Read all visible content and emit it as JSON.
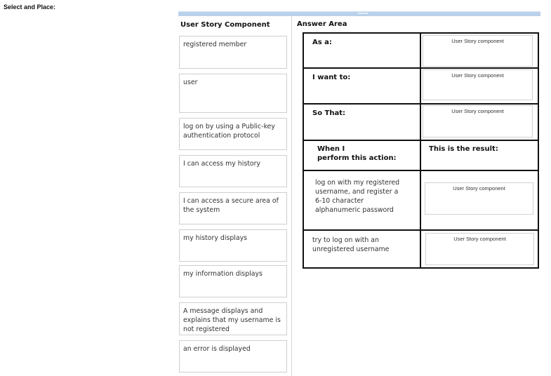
{
  "page": {
    "title": "Select and Place:"
  },
  "components_panel": {
    "heading": "User Story Component",
    "items": [
      {
        "label": "registered member"
      },
      {
        "label": "user"
      },
      {
        "label": "log on by using a Public-key authentication protocol"
      },
      {
        "label": "I can access my history"
      },
      {
        "label": "I can access a secure area of the system"
      },
      {
        "label": "my history displays"
      },
      {
        "label": "my information displays"
      },
      {
        "label": "A message displays and explains that my username is not registered"
      },
      {
        "label": "an error is displayed"
      }
    ]
  },
  "answer_area": {
    "heading": "Answer Area",
    "rows": [
      {
        "label": "As a:",
        "target": "User Story component"
      },
      {
        "label": "I want to:",
        "target": "User Story component"
      },
      {
        "label": "So That:",
        "target": "User Story component"
      }
    ],
    "scenario_header": {
      "action_line1": "When I",
      "action_line2": "perform this action:",
      "result": "This is the result:"
    },
    "scenarios": [
      {
        "action": "log on with my registered username, and register a 6-10 character alphanumeric password",
        "target": "User Story component"
      },
      {
        "action": "try to log on with an unregistered username",
        "target": "User Story component"
      }
    ]
  }
}
